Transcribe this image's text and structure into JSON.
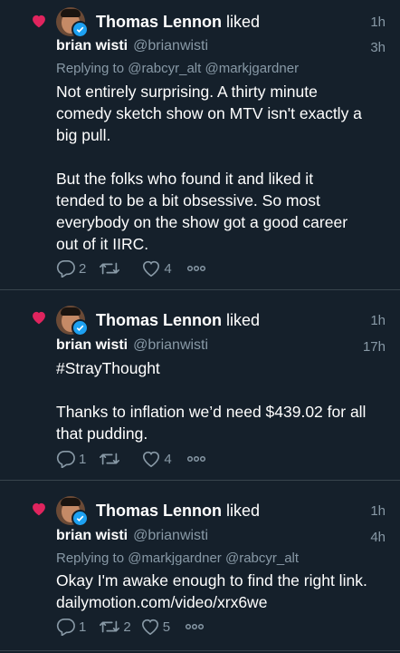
{
  "accent": "#1da1f2",
  "like_color": "#e0245e",
  "items": [
    {
      "liker": "Thomas Lennon",
      "liked_label": "liked",
      "like_time": "1h",
      "author": "brian wisti",
      "handle": "@brianwisti",
      "tweet_time": "3h",
      "replying": "Replying to @rabcyr_alt @markjgardner",
      "lines": [
        "Not entirely surprising. A thirty minute",
        "comedy sketch show on MTV isn't exactly a",
        "big pull.",
        "",
        "But the folks who found it and liked it",
        "tended to be a bit obsessive. So most",
        "everybody on the show got a good career",
        "out of it IIRC."
      ],
      "replies": "2",
      "retweets": "",
      "likes": "4"
    },
    {
      "liker": "Thomas Lennon",
      "liked_label": "liked",
      "like_time": "1h",
      "author": "brian wisti",
      "handle": "@brianwisti",
      "tweet_time": "17h",
      "replying": "",
      "lines": [
        "#StrayThought",
        "",
        "Thanks to inflation we’d need $439.02 for all",
        "that pudding."
      ],
      "replies": "1",
      "retweets": "",
      "likes": "4"
    },
    {
      "liker": "Thomas Lennon",
      "liked_label": "liked",
      "like_time": "1h",
      "author": "brian wisti",
      "handle": "@brianwisti",
      "tweet_time": "4h",
      "replying": "Replying to @markjgardner @rabcyr_alt",
      "lines": [
        "Okay I'm awake enough to find the right link.",
        "dailymotion.com/video/xrx6we"
      ],
      "replies": "1",
      "retweets": "2",
      "likes": "5"
    }
  ]
}
